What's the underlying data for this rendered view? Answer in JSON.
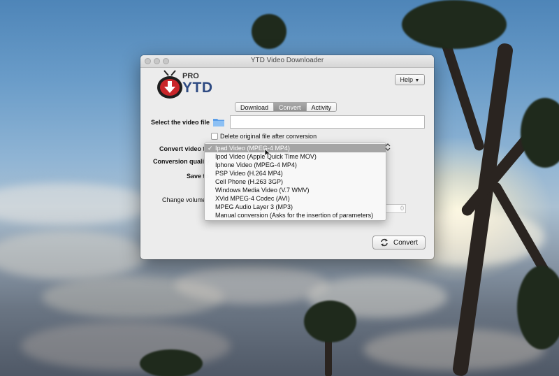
{
  "window": {
    "title": "YTD Video Downloader"
  },
  "logo": {
    "pro": "PRO",
    "ytd": "YTD"
  },
  "toolbar": {
    "help_label": "Help"
  },
  "tabs": [
    {
      "label": "Download",
      "active": false
    },
    {
      "label": "Convert",
      "active": true
    },
    {
      "label": "Activity",
      "active": false
    }
  ],
  "form": {
    "select_file_label": "Select the video file",
    "file_value": "",
    "delete_original_label": "Delete original file after conversion",
    "delete_original_checked": false,
    "convert_to_label": "Convert video to",
    "quality_label": "Conversion quality",
    "save_label": "Save to",
    "volume_label": "Change volume",
    "volume_value": "0"
  },
  "format_menu": {
    "selected_index": 0,
    "options": [
      "Ipad Video (MPEG-4 MP4)",
      "Ipod Video (Apple Quick Time MOV)",
      "Iphone Video (MPEG-4 MP4)",
      "PSP Video (H.264 MP4)",
      "Cell Phone (H.263 3GP)",
      "Windows Media Video (V.7 WMV)",
      "XVid MPEG-4 Codec (AVI)",
      "MPEG Audio Layer 3 (MP3)",
      "Manual conversion (Asks for the insertion of parameters)"
    ]
  },
  "actions": {
    "convert_label": "Convert"
  },
  "icons": {
    "folder": "folder-icon",
    "convert": "refresh-arrows-icon",
    "help_dropdown": "triangle-down-icon",
    "check": "checkmark-icon",
    "stepper": "up-down-chevron-icon",
    "cursor": "mouse-pointer-icon"
  },
  "colors": {
    "accent_blue": "#2e4a82",
    "logo_red": "#c9262a",
    "menu_highlight": "#a5a5a5"
  }
}
